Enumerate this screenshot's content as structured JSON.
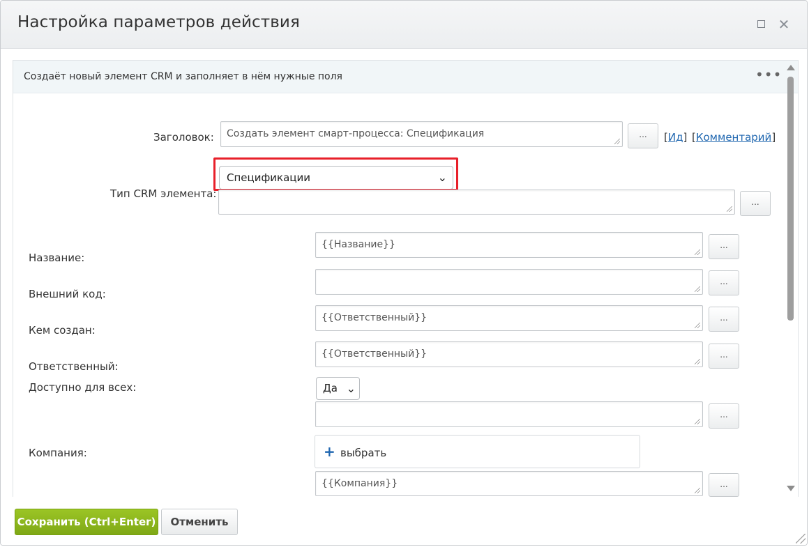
{
  "dialog": {
    "title": "Настройка параметров действия",
    "maximize_icon": "maximize-icon",
    "close_icon": "close-icon",
    "close_glyph": "✕"
  },
  "panel": {
    "description": "Создаёт новый элемент CRM и заполняет в нём нужные поля",
    "more_glyph": "•••"
  },
  "form": {
    "title_label": "Заголовок:",
    "title_value": "Создать элемент смарт-процесса: Спецификация",
    "link_id": "Ид",
    "link_comment": "Комментарий",
    "bracket_open": "[",
    "bracket_close": "]",
    "crm_type_label": "Тип CRM элемента:",
    "crm_type_selected": "Спецификации",
    "name_label": "Название:",
    "name_value": "{{Название}}",
    "external_code_label": "Внешний код:",
    "external_code_value": "",
    "created_by_label": "Кем создан:",
    "created_by_value": "{{Ответственный}}",
    "responsible_label": "Ответственный:",
    "responsible_value": "{{Ответственный}}",
    "available_label": "Доступно для всех:",
    "available_selected": "Да",
    "available_extra_value": "",
    "company_label": "Компания:",
    "company_choose": "выбрать",
    "company_value": "{{Компания}}",
    "dots_label": "...",
    "chevron": "⌄"
  },
  "footer": {
    "save_label": "Сохранить (Ctrl+Enter)",
    "cancel_label": "Отменить"
  },
  "colors": {
    "highlight": "#e8202a",
    "save_button": "#8bb51c",
    "link": "#2067b0"
  }
}
